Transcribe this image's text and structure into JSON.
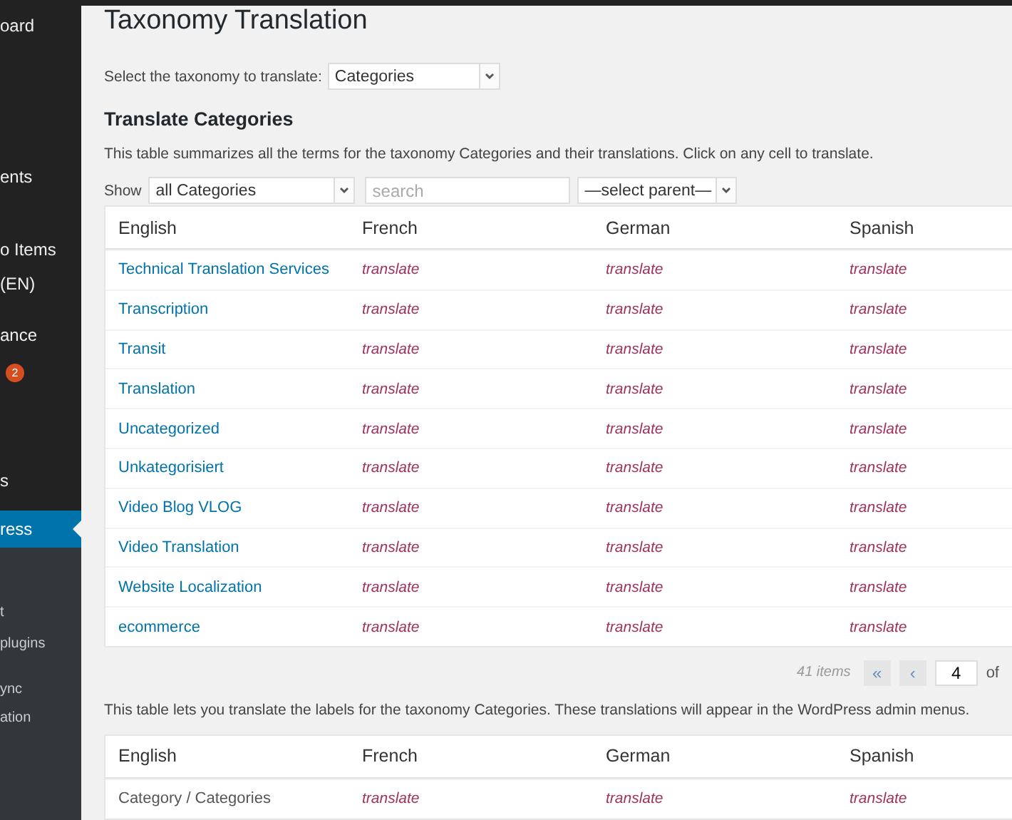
{
  "sidebar": {
    "items": [
      {
        "label": "oard",
        "selected": false
      },
      {
        "label": "ents",
        "selected": false
      },
      {
        "label": "o Items",
        "selected": false
      },
      {
        "label": "(EN)",
        "selected": false
      },
      {
        "label": "ance",
        "selected": false
      },
      {
        "badge": "2",
        "selected": false
      },
      {
        "label": "s",
        "selected": false
      },
      {
        "label": "ress",
        "selected": true
      }
    ],
    "submenu": [
      {
        "label": "t"
      },
      {
        "label": "plugins"
      },
      {
        "label": "ync"
      },
      {
        "label": "ation"
      }
    ]
  },
  "page": {
    "title": "Taxonomy Translation",
    "taxonomy_label": "Select the taxonomy to translate:",
    "taxonomy_select": "Categories",
    "section_title": "Translate Categories",
    "description": "This table summarizes all the terms for the taxonomy Categories and their translations. Click on any cell to translate.",
    "filter": {
      "show_label": "Show",
      "show_select": "all Categories",
      "search_placeholder": "search",
      "parent_select": "—select parent—"
    }
  },
  "terms_table": {
    "columns": [
      "English",
      "French",
      "German",
      "Spanish"
    ],
    "rows": [
      [
        "Technical Translation Services",
        "translate",
        "translate",
        "translate"
      ],
      [
        "Transcription",
        "translate",
        "translate",
        "translate"
      ],
      [
        "Transit",
        "translate",
        "translate",
        "translate"
      ],
      [
        "Translation",
        "translate",
        "translate",
        "translate"
      ],
      [
        "Uncategorized",
        "translate",
        "translate",
        "translate"
      ],
      [
        "Unkategorisiert",
        "translate",
        "translate",
        "translate"
      ],
      [
        "Video Blog VLOG",
        "translate",
        "translate",
        "translate"
      ],
      [
        "Video Translation",
        "translate",
        "translate",
        "translate"
      ],
      [
        "Website Localization",
        "translate",
        "translate",
        "translate"
      ],
      [
        "ecommerce",
        "translate",
        "translate",
        "translate"
      ]
    ]
  },
  "pagination": {
    "count": "41 items",
    "first": "«",
    "prev": "‹",
    "page": "4",
    "of": "of"
  },
  "labels_description": "This table lets you translate the labels for the taxonomy Categories. These translations will appear in the WordPress admin menus.",
  "labels_table": {
    "columns": [
      "English",
      "French",
      "German",
      "Spanish"
    ],
    "rows": [
      [
        "Category / Categories",
        "translate",
        "translate",
        "translate"
      ]
    ]
  }
}
